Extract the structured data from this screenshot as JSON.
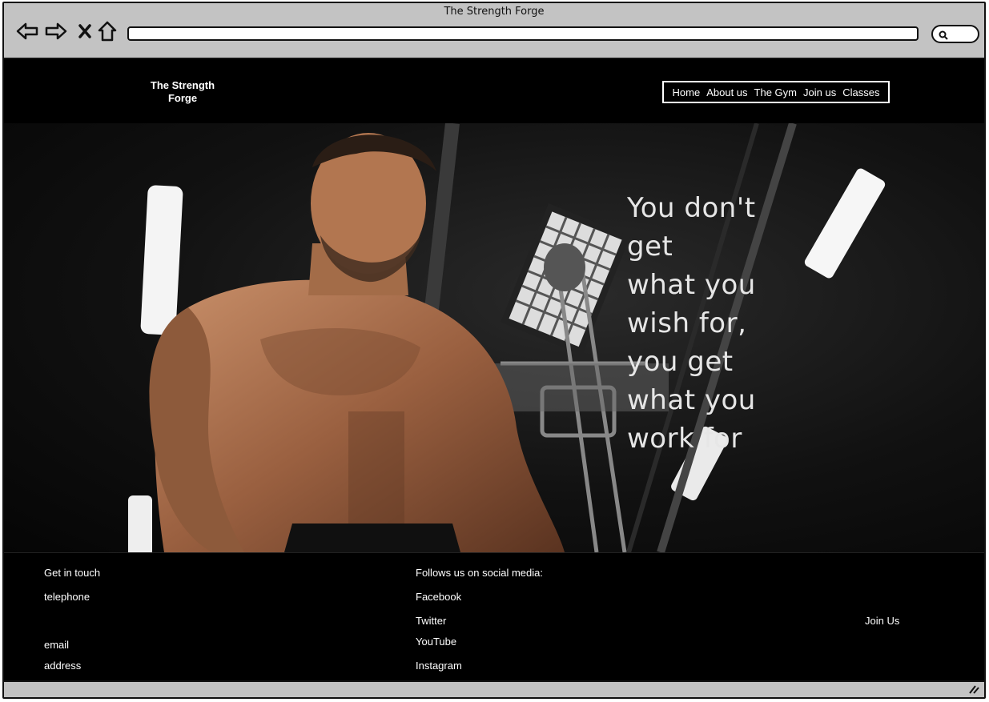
{
  "browser": {
    "title": "The Strength Forge",
    "address": "",
    "icons": [
      "back-arrow-icon",
      "forward-arrow-icon",
      "close-icon",
      "home-icon",
      "search-icon",
      "resize-grip-icon"
    ]
  },
  "site": {
    "logo_line1": "The Strength",
    "logo_line2": "Forge",
    "nav": [
      "Home",
      "About us",
      "The Gym",
      "Join us",
      "Classes"
    ]
  },
  "hero": {
    "quote_lines": [
      "You don't",
      "get",
      "what you",
      "wish for,",
      "you get",
      "what you",
      "work for"
    ]
  },
  "footer": {
    "contact_heading": "Get in touch",
    "telephone": "telephone",
    "email": "email",
    "address": "address",
    "social_heading": "Follows us on social media:",
    "social": [
      "Facebook",
      "Twitter",
      "YouTube",
      "Instagram"
    ],
    "join": "Join Us"
  },
  "colors": {
    "browser_chrome": "#c3c3c3",
    "page_background": "#000000",
    "text": "#ffffff",
    "quote_text": "#e6e6e6"
  }
}
